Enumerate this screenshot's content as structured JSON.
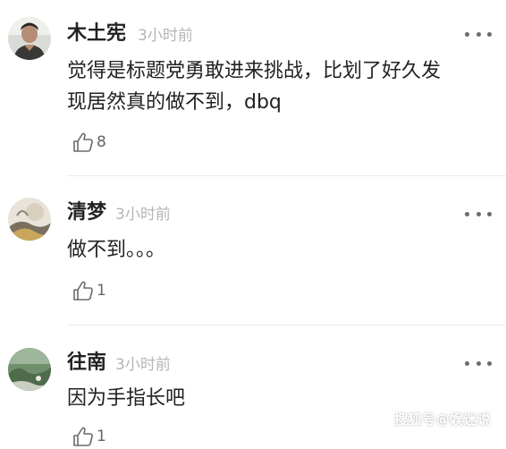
{
  "comments": [
    {
      "author": "木土宪",
      "time": "3小时前",
      "text_lines": [
        "觉得是标题党勇敢进来挑战，比划了好久发",
        "现居然真的做不到，dbq"
      ],
      "likes": "8",
      "avatar_icon": "person-photo-avatar"
    },
    {
      "author": "清梦",
      "time": "3小时前",
      "text_lines": [
        "做不到。。。"
      ],
      "likes": "1",
      "avatar_icon": "illustration-avatar"
    },
    {
      "author": "往南",
      "time": "3小时前",
      "text_lines": [
        "因为手指长吧"
      ],
      "likes": "1",
      "avatar_icon": "landscape-photo-avatar"
    }
  ],
  "icons": {
    "more": "more-dots-icon",
    "like": "thumbs-up-icon"
  },
  "watermark": "搜狐号@娱迷说",
  "colors": {
    "author": "#222222",
    "time": "#b5b5b5",
    "divider": "#ececec",
    "icon": "#6b6b6b"
  }
}
